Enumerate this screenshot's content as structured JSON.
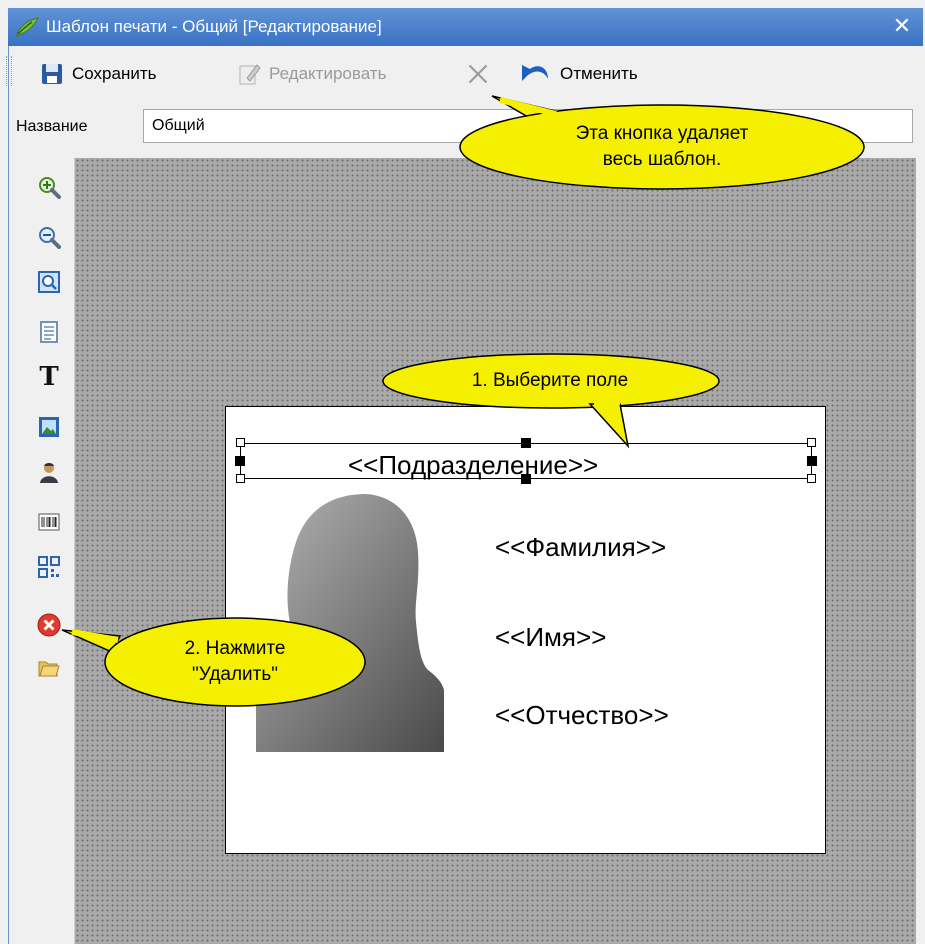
{
  "window": {
    "title": "Шаблон печати - Общий [Редактирование]",
    "close_label": "✕"
  },
  "toolbar": {
    "save_label": "Сохранить",
    "edit_label": "Редактировать",
    "cancel_label": "Отменить"
  },
  "name_field": {
    "label": "Название",
    "value": "Общий"
  },
  "card": {
    "department": "<<Подразделение>>",
    "last_name": "<<Фамилия>>",
    "first_name": "<<Имя>>",
    "patronymic": "<<Отчество>>"
  },
  "callouts": {
    "delete_template_line1": "Эта кнопка удаляет",
    "delete_template_line2": "весь шаблон.",
    "select_field": "1. Выберите поле",
    "press_delete_line1": "2. Нажмите",
    "press_delete_line2": "\"Удалить\""
  },
  "side_tools": [
    "zoom-in-icon",
    "zoom-out-icon",
    "preview-icon",
    "page-icon",
    "text-icon",
    "image-icon",
    "photo-icon",
    "barcode-icon",
    "qr-code-icon",
    "delete-icon",
    "open-folder-icon"
  ],
  "colors": {
    "titlebar": "#3a72c4",
    "callout_fill": "#f5f000",
    "canvas": "#a9a9a9"
  }
}
